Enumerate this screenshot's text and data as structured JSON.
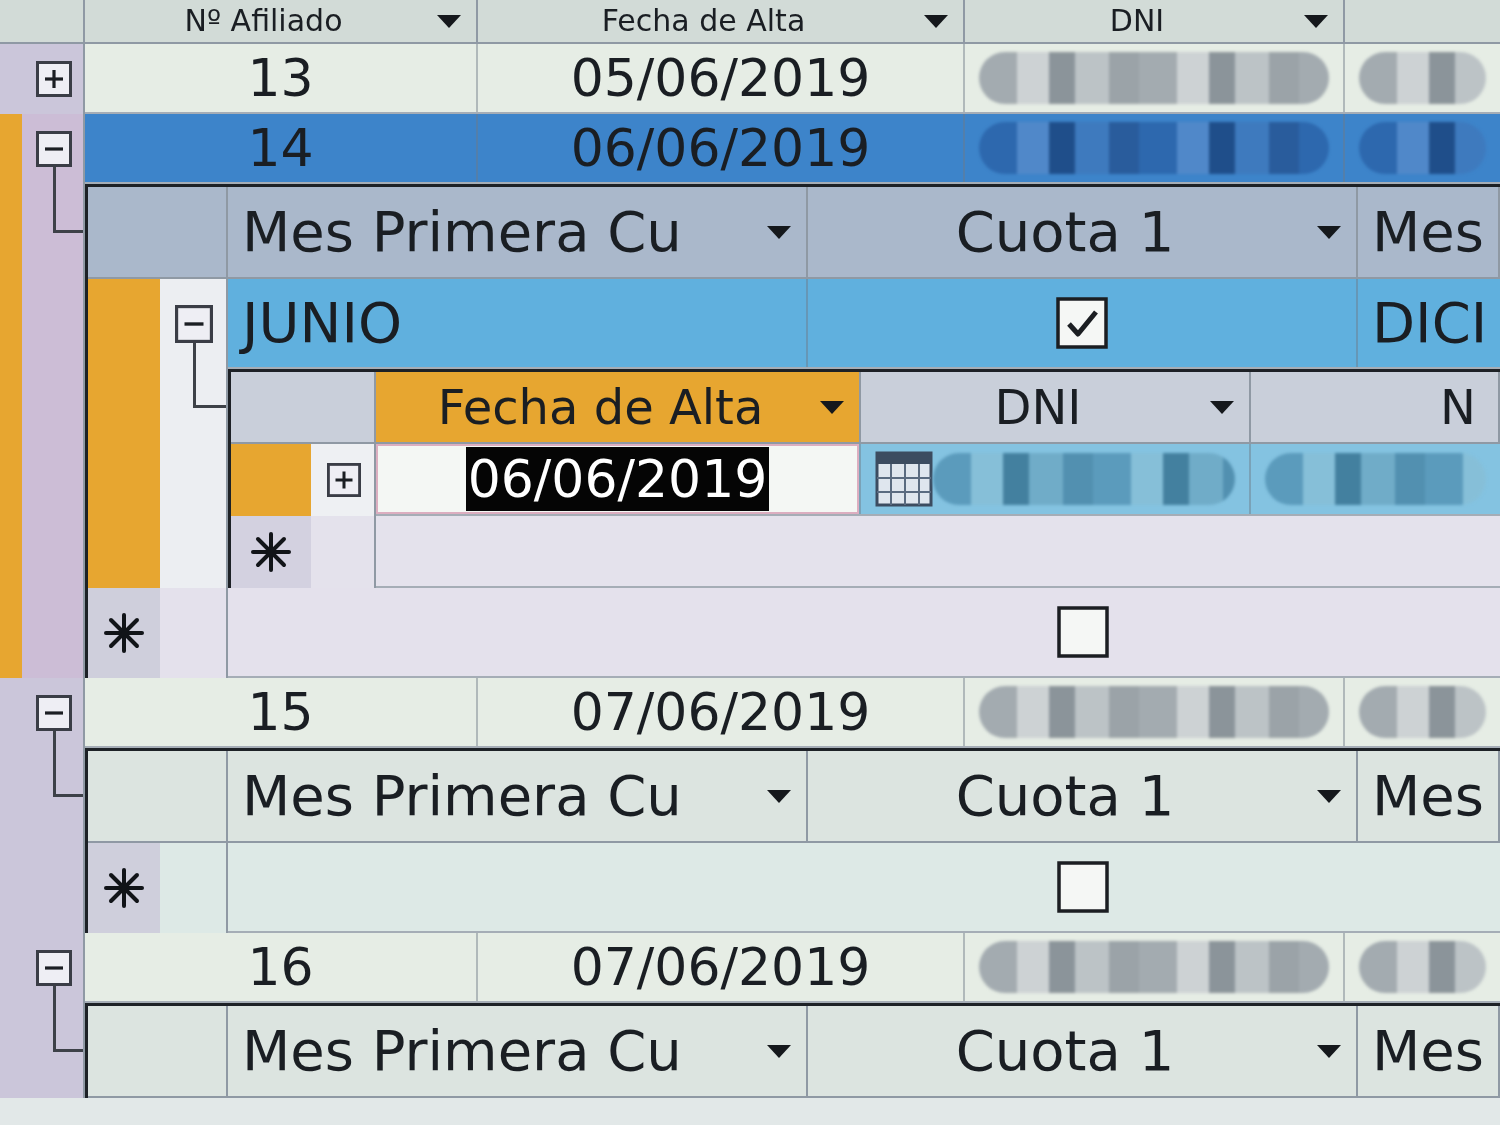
{
  "table": {
    "columns": [
      {
        "label": "Nº Afiliado",
        "selected": false
      },
      {
        "label": "Fecha de Alta",
        "selected": false
      },
      {
        "label": "DNI",
        "selected": false
      }
    ],
    "rows": [
      {
        "n_afiliado": "13",
        "fecha_de_alta": "05/06/2019",
        "dni_redacted": true,
        "selected": false,
        "expanded": false
      },
      {
        "n_afiliado": "14",
        "fecha_de_alta": "06/06/2019",
        "dni_redacted": true,
        "selected": true,
        "expanded": true,
        "subdatasheet": {
          "columns": [
            {
              "label": "Mes Primera Cu",
              "selected": false
            },
            {
              "label": "Cuota 1",
              "selected": false
            },
            {
              "label": "Mes",
              "selected": false
            }
          ],
          "rows": [
            {
              "kind": "record",
              "mes_primera_cuota": "JUNIO",
              "cuota_1": true,
              "column_3": "DICI",
              "selected": true,
              "expanded": true,
              "subdatasheet": {
                "columns": [
                  {
                    "label": "Fecha de Alta",
                    "selected": true
                  },
                  {
                    "label": "DNI",
                    "selected": false
                  },
                  {
                    "label": "N",
                    "selected": false
                  }
                ],
                "rows": [
                  {
                    "kind": "record",
                    "fecha_de_alta": "06/06/2019",
                    "text_highlighted": true,
                    "dni_redacted": true,
                    "selected": true,
                    "expanded": false
                  },
                  {
                    "kind": "new",
                    "selected": false
                  }
                ]
              }
            },
            {
              "kind": "new",
              "cuota_1": false,
              "selected": false
            }
          ]
        }
      },
      {
        "n_afiliado": "15",
        "fecha_de_alta": "07/06/2019",
        "dni_redacted": true,
        "selected": false,
        "expanded": true,
        "subdatasheet": {
          "columns": [
            {
              "label": "Mes Primera Cu",
              "selected": false
            },
            {
              "label": "Cuota 1",
              "selected": false
            },
            {
              "label": "Mes",
              "selected": false
            }
          ],
          "rows": [
            {
              "kind": "new",
              "cuota_1": false,
              "selected": false
            }
          ]
        }
      },
      {
        "n_afiliado": "16",
        "fecha_de_alta": "07/06/2019",
        "dni_redacted": true,
        "selected": false,
        "expanded": true,
        "subdatasheet": {
          "columns": [
            {
              "label": "Mes Primera Cu",
              "selected": false
            },
            {
              "label": "Cuota 1",
              "selected": false
            },
            {
              "label": "Mes",
              "selected": false
            }
          ]
        }
      }
    ]
  }
}
